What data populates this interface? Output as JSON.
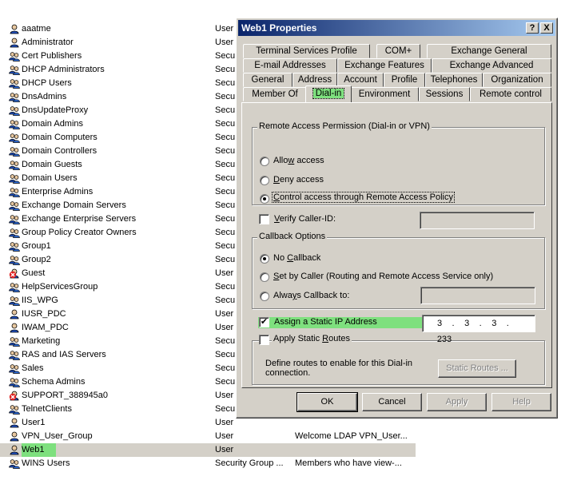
{
  "list": {
    "rows": [
      {
        "name": "aaatme",
        "type": "User",
        "desc": "",
        "icon": "user-icon"
      },
      {
        "name": "Administrator",
        "type": "User",
        "desc": "",
        "icon": "user-icon"
      },
      {
        "name": "Cert Publishers",
        "type": "Secu",
        "desc": "",
        "icon": "group-icon"
      },
      {
        "name": "DHCP Administrators",
        "type": "Secu",
        "desc": "",
        "icon": "group-icon"
      },
      {
        "name": "DHCP Users",
        "type": "Secu",
        "desc": "",
        "icon": "group-icon"
      },
      {
        "name": "DnsAdmins",
        "type": "Secu",
        "desc": "",
        "icon": "group-icon"
      },
      {
        "name": "DnsUpdateProxy",
        "type": "Secu",
        "desc": "",
        "icon": "group-icon"
      },
      {
        "name": "Domain Admins",
        "type": "Secu",
        "desc": "",
        "icon": "group-icon"
      },
      {
        "name": "Domain Computers",
        "type": "Secu",
        "desc": "",
        "icon": "group-icon"
      },
      {
        "name": "Domain Controllers",
        "type": "Secu",
        "desc": "",
        "icon": "group-icon"
      },
      {
        "name": "Domain Guests",
        "type": "Secu",
        "desc": "",
        "icon": "group-icon"
      },
      {
        "name": "Domain Users",
        "type": "Secu",
        "desc": "",
        "icon": "group-icon"
      },
      {
        "name": "Enterprise Admins",
        "type": "Secu",
        "desc": "",
        "icon": "group-icon"
      },
      {
        "name": "Exchange Domain Servers",
        "type": "Secu",
        "desc": "",
        "icon": "group-icon"
      },
      {
        "name": "Exchange Enterprise Servers",
        "type": "Secu",
        "desc": "",
        "icon": "group-icon"
      },
      {
        "name": "Group Policy Creator Owners",
        "type": "Secu",
        "desc": "",
        "icon": "group-icon"
      },
      {
        "name": "Group1",
        "type": "Secu",
        "desc": "",
        "icon": "group-icon"
      },
      {
        "name": "Group2",
        "type": "Secu",
        "desc": "",
        "icon": "group-icon"
      },
      {
        "name": "Guest",
        "type": "User",
        "desc": "",
        "icon": "disabled-user-icon"
      },
      {
        "name": "HelpServicesGroup",
        "type": "Secu",
        "desc": "",
        "icon": "group-icon"
      },
      {
        "name": "IIS_WPG",
        "type": "Secu",
        "desc": "",
        "icon": "group-icon"
      },
      {
        "name": "IUSR_PDC",
        "type": "User",
        "desc": "",
        "icon": "user-icon"
      },
      {
        "name": "IWAM_PDC",
        "type": "User",
        "desc": "",
        "icon": "user-icon"
      },
      {
        "name": "Marketing",
        "type": "Secu",
        "desc": "",
        "icon": "group-icon"
      },
      {
        "name": "RAS and IAS Servers",
        "type": "Secu",
        "desc": "",
        "icon": "group-icon"
      },
      {
        "name": "Sales",
        "type": "Secu",
        "desc": "",
        "icon": "group-icon"
      },
      {
        "name": "Schema Admins",
        "type": "Secu",
        "desc": "",
        "icon": "group-icon"
      },
      {
        "name": "SUPPORT_388945a0",
        "type": "User",
        "desc": "",
        "icon": "disabled-user-icon"
      },
      {
        "name": "TelnetClients",
        "type": "Secu",
        "desc": "",
        "icon": "group-icon"
      },
      {
        "name": "User1",
        "type": "User",
        "desc": "",
        "icon": "user-icon"
      },
      {
        "name": "VPN_User_Group",
        "type": "User",
        "desc": "Welcome LDAP VPN_User...",
        "icon": "user-icon"
      },
      {
        "name": "Web1",
        "type": "User",
        "desc": "",
        "icon": "user-icon",
        "selected": true
      },
      {
        "name": "WINS Users",
        "type": "Security Group ...",
        "desc": "Members who have view-...",
        "icon": "group-icon"
      }
    ]
  },
  "dialog": {
    "title": "Web1 Properties",
    "help_glyph": "?",
    "close_glyph": "X",
    "tabs_row1": [
      "Terminal Services Profile",
      "COM+",
      "Exchange General"
    ],
    "tabs_row2": [
      "E-mail Addresses",
      "Exchange Features",
      "Exchange Advanced"
    ],
    "tabs_row3": [
      "General",
      "Address",
      "Account",
      "Profile",
      "Telephones",
      "Organization"
    ],
    "tabs_row4": [
      "Member Of",
      "Dial-in",
      "Environment",
      "Sessions",
      "Remote control"
    ],
    "active_tab": "Dial-in",
    "remote_access": {
      "title": "Remote Access Permission (Dial-in or VPN)",
      "allow": {
        "pre": "Allo",
        "key": "w",
        "post": " access"
      },
      "deny": {
        "pre": "",
        "key": "D",
        "post": "eny access"
      },
      "policy": {
        "pre": "",
        "key": "C",
        "post": "ontrol access through Remote Access Policy"
      },
      "selected": "policy"
    },
    "verify": {
      "pre": "",
      "key": "V",
      "post": "erify Caller-ID:",
      "checked": false,
      "value": ""
    },
    "callback": {
      "title": "Callback Options",
      "none": {
        "pre": "No ",
        "key": "C",
        "post": "allback"
      },
      "caller": {
        "pre": "",
        "key": "S",
        "post": "et by Caller (Routing and Remote Access Service only)"
      },
      "always": {
        "pre": "Alwa",
        "key": "y",
        "post": "s Callback to:"
      },
      "selected": "none",
      "always_value": ""
    },
    "static_ip": {
      "label": "Assign a Static IP Address",
      "checked": true,
      "octets": [
        "3",
        "3",
        "3",
        "233"
      ],
      "dot": "."
    },
    "static_routes": {
      "pre": "Apply Static ",
      "key": "R",
      "post": "outes",
      "checked": false,
      "description": "Define routes to enable for this Dial-in connection.",
      "button": "Static Routes ..."
    },
    "buttons": {
      "ok": "OK",
      "cancel": "Cancel",
      "apply": "Apply",
      "help": "Help"
    },
    "check_glyph": "✔",
    "highlight_color": "#7ee07e"
  }
}
